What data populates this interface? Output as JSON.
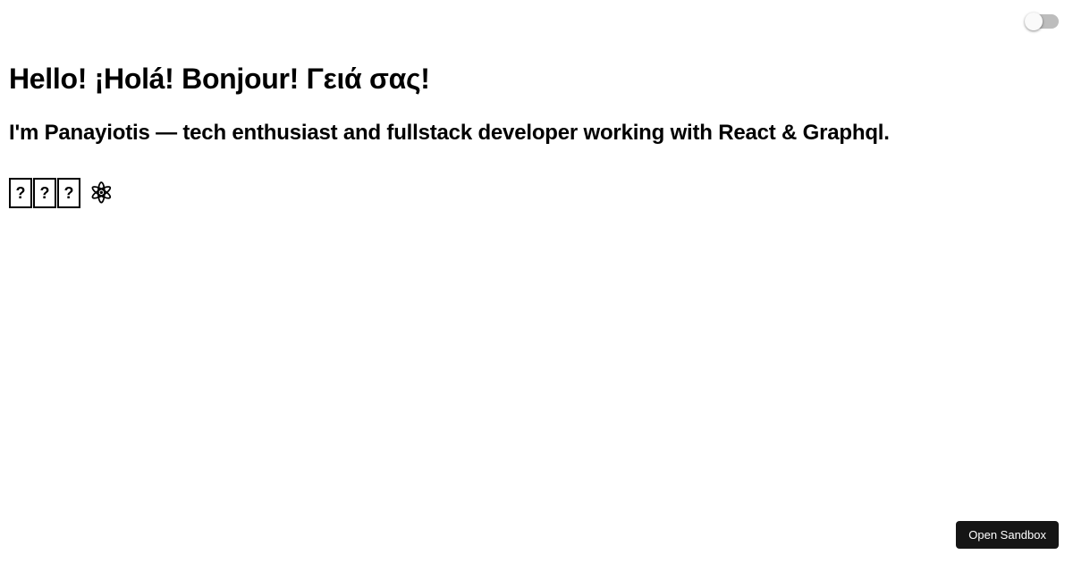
{
  "toggle": {
    "state": "off"
  },
  "heading": "Hello! ¡Holá! Bonjour! Γειά σας!",
  "subheading": "I'm Panayiotis — tech enthusiast and fullstack developer working with React & Graphql.",
  "emoji_line": {
    "tofu_glyph": "?",
    "atom": "⚛"
  },
  "sandbox_button": {
    "label": "Open Sandbox"
  }
}
